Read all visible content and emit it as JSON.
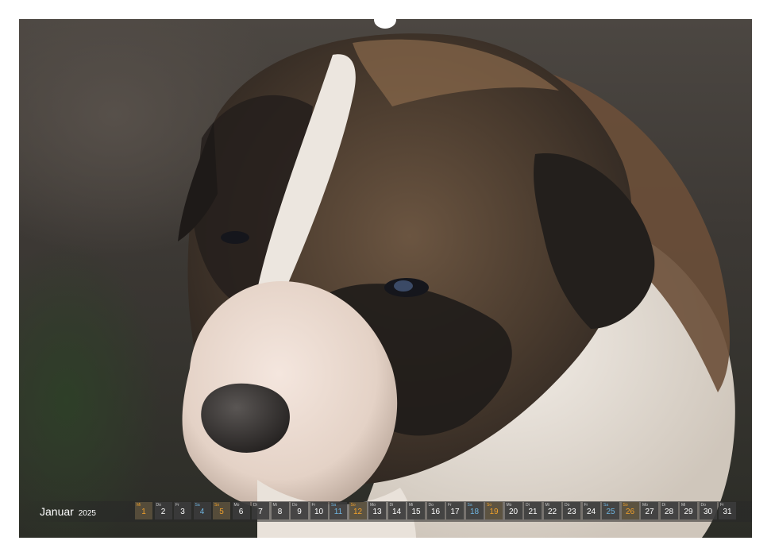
{
  "calendar": {
    "month": "Januar",
    "year": "2025",
    "days": [
      {
        "wd": "Mi",
        "d": "1",
        "type": "sun"
      },
      {
        "wd": "Do",
        "d": "2",
        "type": "day"
      },
      {
        "wd": "Fr",
        "d": "3",
        "type": "day"
      },
      {
        "wd": "Sa",
        "d": "4",
        "type": "sat"
      },
      {
        "wd": "So",
        "d": "5",
        "type": "sun"
      },
      {
        "wd": "Mo",
        "d": "6",
        "type": "day"
      },
      {
        "wd": "Di",
        "d": "7",
        "type": "day"
      },
      {
        "wd": "Mi",
        "d": "8",
        "type": "day"
      },
      {
        "wd": "Do",
        "d": "9",
        "type": "day"
      },
      {
        "wd": "Fr",
        "d": "10",
        "type": "day"
      },
      {
        "wd": "Sa",
        "d": "11",
        "type": "sat"
      },
      {
        "wd": "So",
        "d": "12",
        "type": "sun"
      },
      {
        "wd": "Mo",
        "d": "13",
        "type": "day"
      },
      {
        "wd": "Di",
        "d": "14",
        "type": "day"
      },
      {
        "wd": "Mi",
        "d": "15",
        "type": "day"
      },
      {
        "wd": "Do",
        "d": "16",
        "type": "day"
      },
      {
        "wd": "Fr",
        "d": "17",
        "type": "day"
      },
      {
        "wd": "Sa",
        "d": "18",
        "type": "sat"
      },
      {
        "wd": "So",
        "d": "19",
        "type": "sun"
      },
      {
        "wd": "Mo",
        "d": "20",
        "type": "day"
      },
      {
        "wd": "Di",
        "d": "21",
        "type": "day"
      },
      {
        "wd": "Mi",
        "d": "22",
        "type": "day"
      },
      {
        "wd": "Do",
        "d": "23",
        "type": "day"
      },
      {
        "wd": "Fr",
        "d": "24",
        "type": "day"
      },
      {
        "wd": "Sa",
        "d": "25",
        "type": "sat"
      },
      {
        "wd": "So",
        "d": "26",
        "type": "sun"
      },
      {
        "wd": "Mo",
        "d": "27",
        "type": "day"
      },
      {
        "wd": "Di",
        "d": "28",
        "type": "day"
      },
      {
        "wd": "Mi",
        "d": "29",
        "type": "day"
      },
      {
        "wd": "Do",
        "d": "30",
        "type": "day"
      },
      {
        "wd": "Fr",
        "d": "31",
        "type": "day"
      }
    ]
  },
  "photo": {
    "subject": "puppy-photo",
    "colors": {
      "fur_brown": "#7a5a3e",
      "fur_dark": "#2a2622",
      "fur_white": "#ece6df",
      "nose": "#3a3634"
    }
  }
}
